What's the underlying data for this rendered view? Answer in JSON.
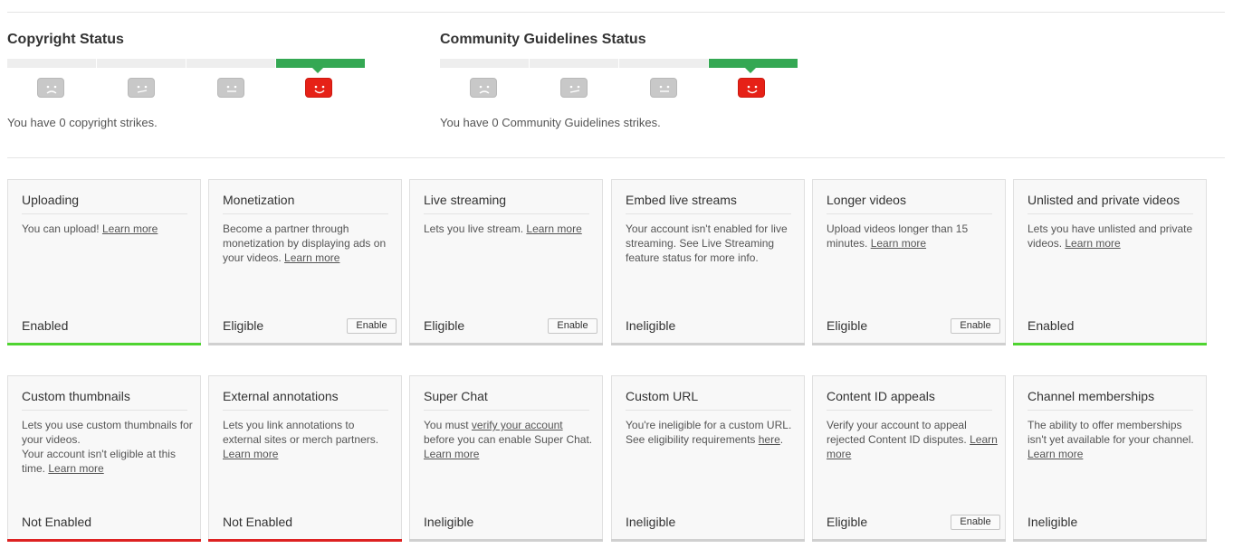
{
  "copyright": {
    "title": "Copyright Status",
    "strikes_text": "You have 0 copyright strikes.",
    "level": 4,
    "faces": [
      "sad-face-icon",
      "meh-face-icon",
      "neutral-face-icon",
      "happy-face-icon"
    ]
  },
  "community": {
    "title": "Community Guidelines Status",
    "strikes_text": "You have 0 Community Guidelines strikes.",
    "level": 4,
    "faces": [
      "sad-face-icon",
      "meh-face-icon",
      "neutral-face-icon",
      "happy-face-icon"
    ]
  },
  "colors": {
    "meter_active": "#34a853",
    "enabled_bar": "#4fd431",
    "not_enabled_bar": "#dd2222",
    "happy_face": "#e62117"
  },
  "enable_label": "Enable",
  "features": [
    {
      "title": "Uploading",
      "desc": "You can upload! ",
      "links": [
        {
          "text": "Learn more"
        }
      ],
      "state": "Enabled",
      "bar": "green",
      "button": false
    },
    {
      "title": "Monetization",
      "desc": "Become a partner through monetization by displaying ads on your videos. ",
      "links": [
        {
          "text": "Learn more"
        }
      ],
      "state": "Eligible",
      "bar": "gray",
      "button": true
    },
    {
      "title": "Live streaming",
      "desc": "Lets you live stream. ",
      "links": [
        {
          "text": "Learn more"
        }
      ],
      "state": "Eligible",
      "bar": "gray",
      "button": true
    },
    {
      "title": "Embed live streams",
      "desc": "Your account isn't enabled for live streaming. See Live Streaming feature status for more info.",
      "links": [],
      "state": "Ineligible",
      "bar": "gray",
      "button": false
    },
    {
      "title": "Longer videos",
      "desc": "Upload videos longer than 15 minutes. ",
      "links": [
        {
          "text": "Learn more"
        }
      ],
      "state": "Eligible",
      "bar": "gray",
      "button": true
    },
    {
      "title": "Unlisted and private videos",
      "desc": "Lets you have unlisted and private videos. ",
      "links": [
        {
          "text": "Learn more"
        }
      ],
      "state": "Enabled",
      "bar": "green",
      "button": false
    },
    {
      "title": "Custom thumbnails",
      "desc": "Lets you use custom thumbnails for your videos.\nYour account isn't eligible at this time. ",
      "links": [
        {
          "text": "Learn more"
        }
      ],
      "state": "Not Enabled",
      "bar": "red",
      "button": false
    },
    {
      "title": "External annotations",
      "desc": "Lets you link annotations to external sites or merch partners. ",
      "links": [
        {
          "text": "Learn more"
        }
      ],
      "state": "Not Enabled",
      "bar": "red",
      "button": false
    },
    {
      "title": "Super Chat",
      "desc_parts": [
        "You must ",
        "verify your account",
        " before you can enable Super Chat. ",
        "Learn more"
      ],
      "state": "Ineligible",
      "bar": "gray",
      "button": false
    },
    {
      "title": "Custom URL",
      "desc_parts": [
        "You're ineligible for a custom URL. See eligibility requirements ",
        "here",
        "."
      ],
      "state": "Ineligible",
      "bar": "gray",
      "button": false
    },
    {
      "title": "Content ID appeals",
      "desc": "Verify your account to appeal rejected Content ID disputes. ",
      "links": [
        {
          "text": "Learn more"
        }
      ],
      "state": "Eligible",
      "bar": "gray",
      "button": true
    },
    {
      "title": "Channel memberships",
      "desc": "The ability to offer memberships isn't yet available for your channel. ",
      "links": [
        {
          "text": "Learn more"
        }
      ],
      "state": "Ineligible",
      "bar": "gray",
      "button": false
    }
  ]
}
